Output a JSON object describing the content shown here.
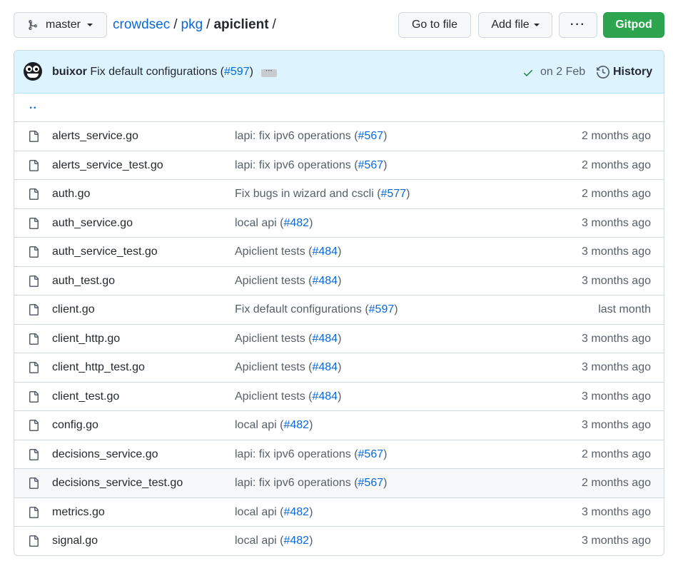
{
  "toolbar": {
    "branch": "master",
    "breadcrumb": [
      {
        "label": "crowdsec",
        "is_link": true
      },
      {
        "label": "pkg",
        "is_link": true
      },
      {
        "label": "apiclient",
        "is_link": false
      }
    ],
    "separator": "/",
    "go_to_file": "Go to file",
    "add_file": "Add file",
    "more": "···",
    "gitpod": "Gitpod"
  },
  "latest_commit": {
    "author": "buixor",
    "message": "Fix default configurations (",
    "pr": "#597",
    "message_end": ")",
    "ellipsis": "···",
    "date": "on 2 Feb",
    "history": "History"
  },
  "parent_dir": "..",
  "files": [
    {
      "name": "alerts_service.go",
      "msg": "lapi: fix ipv6 operations (",
      "pr": "#567",
      "age": "2 months ago"
    },
    {
      "name": "alerts_service_test.go",
      "msg": "lapi: fix ipv6 operations (",
      "pr": "#567",
      "age": "2 months ago"
    },
    {
      "name": "auth.go",
      "msg": "Fix bugs in wizard and cscli (",
      "pr": "#577",
      "age": "2 months ago"
    },
    {
      "name": "auth_service.go",
      "msg": "local api (",
      "pr": "#482",
      "age": "3 months ago"
    },
    {
      "name": "auth_service_test.go",
      "msg": "Apiclient tests (",
      "pr": "#484",
      "age": "3 months ago"
    },
    {
      "name": "auth_test.go",
      "msg": "Apiclient tests (",
      "pr": "#484",
      "age": "3 months ago"
    },
    {
      "name": "client.go",
      "msg": "Fix default configurations (",
      "pr": "#597",
      "age": "last month"
    },
    {
      "name": "client_http.go",
      "msg": "Apiclient tests (",
      "pr": "#484",
      "age": "3 months ago"
    },
    {
      "name": "client_http_test.go",
      "msg": "Apiclient tests (",
      "pr": "#484",
      "age": "3 months ago"
    },
    {
      "name": "client_test.go",
      "msg": "Apiclient tests (",
      "pr": "#484",
      "age": "3 months ago"
    },
    {
      "name": "config.go",
      "msg": "local api (",
      "pr": "#482",
      "age": "3 months ago"
    },
    {
      "name": "decisions_service.go",
      "msg": "lapi: fix ipv6 operations (",
      "pr": "#567",
      "age": "2 months ago"
    },
    {
      "name": "decisions_service_test.go",
      "msg": "lapi: fix ipv6 operations (",
      "pr": "#567",
      "age": "2 months ago",
      "hovered": true
    },
    {
      "name": "metrics.go",
      "msg": "local api (",
      "pr": "#482",
      "age": "3 months ago"
    },
    {
      "name": "signal.go",
      "msg": "local api (",
      "pr": "#482",
      "age": "3 months ago"
    }
  ],
  "colors": {
    "link": "#0969da",
    "commit_bar": "#ddf4ff",
    "gitpod": "#2da44e",
    "success": "#1a7f37"
  }
}
